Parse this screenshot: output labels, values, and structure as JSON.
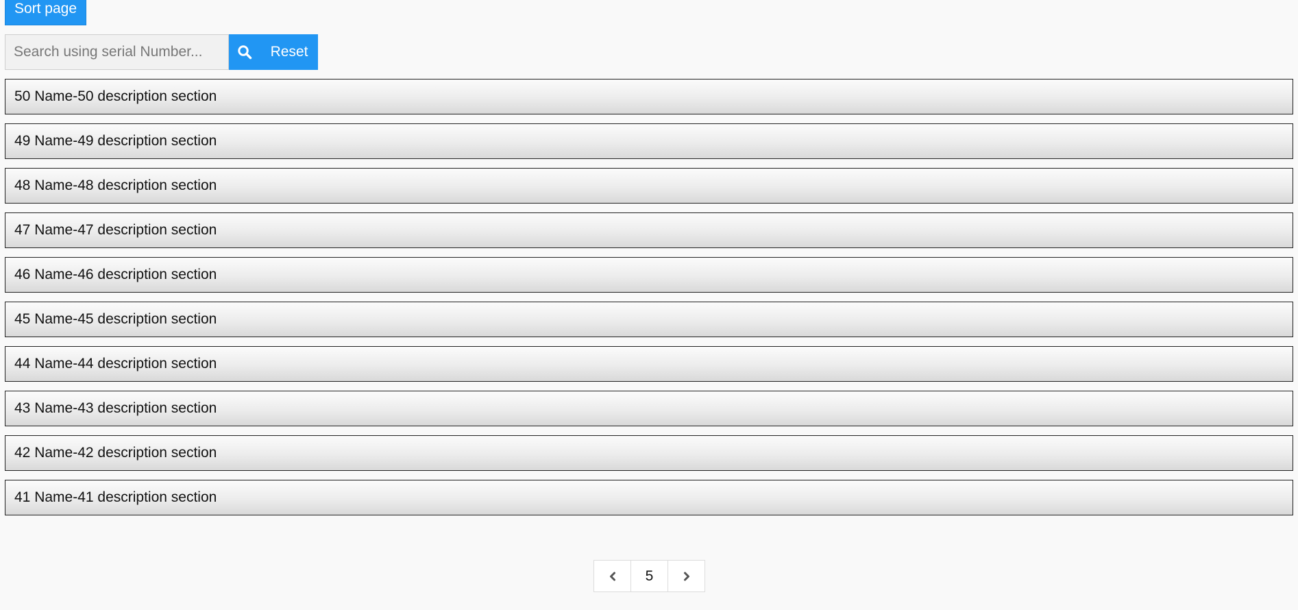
{
  "toolbar": {
    "sort_label": "Sort page"
  },
  "search": {
    "placeholder": "Search using serial Number...",
    "value": "",
    "search_icon": "search-icon",
    "reset_label": "Reset"
  },
  "colors": {
    "accent": "#2196f3",
    "background": "#f9f9f9"
  },
  "list": {
    "items": [
      {
        "label": "50 Name-50 description section"
      },
      {
        "label": "49 Name-49 description section"
      },
      {
        "label": "48 Name-48 description section"
      },
      {
        "label": "47 Name-47 description section"
      },
      {
        "label": "46 Name-46 description section"
      },
      {
        "label": "45 Name-45 description section"
      },
      {
        "label": "44 Name-44 description section"
      },
      {
        "label": "43 Name-43 description section"
      },
      {
        "label": "42 Name-42 description section"
      },
      {
        "label": "41 Name-41 description section"
      }
    ]
  },
  "pagination": {
    "prev_icon": "chevron-left-icon",
    "current_page": "5",
    "next_icon": "chevron-right-icon"
  }
}
